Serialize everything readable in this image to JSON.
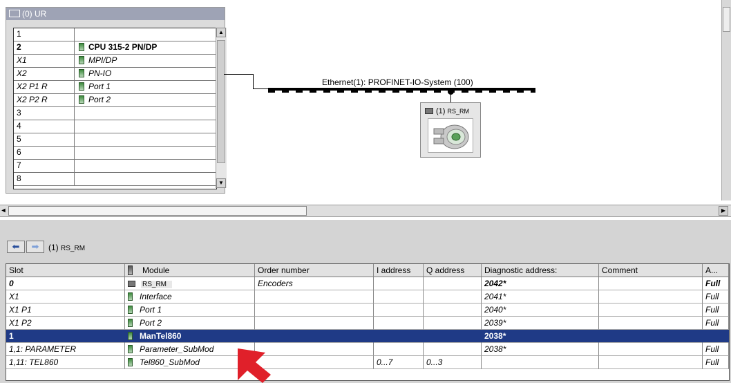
{
  "rack": {
    "title": "(0) UR",
    "rows": [
      {
        "slot": "1",
        "module": "",
        "icon": false,
        "style": ""
      },
      {
        "slot": "2",
        "module": "CPU 315-2 PN/DP",
        "icon": true,
        "style": "bold"
      },
      {
        "slot": "X1",
        "module": "MPI/DP",
        "icon": true,
        "style": "italic"
      },
      {
        "slot": "X2",
        "module": "PN-IO",
        "icon": true,
        "style": "italic"
      },
      {
        "slot": "X2 P1 R",
        "module": "Port 1",
        "icon": true,
        "style": "italic"
      },
      {
        "slot": "X2 P2 R",
        "module": "Port 2",
        "icon": true,
        "style": "italic"
      },
      {
        "slot": "3",
        "module": "",
        "icon": false,
        "style": ""
      },
      {
        "slot": "4",
        "module": "",
        "icon": false,
        "style": ""
      },
      {
        "slot": "5",
        "module": "",
        "icon": false,
        "style": ""
      },
      {
        "slot": "6",
        "module": "",
        "icon": false,
        "style": ""
      },
      {
        "slot": "7",
        "module": "",
        "icon": false,
        "style": ""
      },
      {
        "slot": "8",
        "module": "",
        "icon": false,
        "style": ""
      }
    ]
  },
  "network": {
    "label": "Ethernet(1): PROFINET-IO-System (100)",
    "device_label_prefix": "(1)",
    "device_label_name": "RS_RM"
  },
  "detail": {
    "nav_prefix": "(1)",
    "nav_name": "RS_RM",
    "columns": [
      "Slot",
      "Module",
      "Order number",
      "I address",
      "Q address",
      "Diagnostic address:",
      "Comment",
      "A..."
    ],
    "rows": [
      {
        "slot": "0",
        "module": "RS_RM",
        "order": "Encoders",
        "i": "",
        "q": "",
        "diag": "2042*",
        "comment": "",
        "a": "Full",
        "icon": "device",
        "style": "bolditalic"
      },
      {
        "slot": "X1",
        "module": "Interface",
        "order": "",
        "i": "",
        "q": "",
        "diag": "2041*",
        "comment": "",
        "a": "Full",
        "icon": "module",
        "style": "italic"
      },
      {
        "slot": "X1 P1",
        "module": "Port 1",
        "order": "",
        "i": "",
        "q": "",
        "diag": "2040*",
        "comment": "",
        "a": "Full",
        "icon": "module",
        "style": "italic"
      },
      {
        "slot": "X1 P2",
        "module": "Port 2",
        "order": "",
        "i": "",
        "q": "",
        "diag": "2039*",
        "comment": "",
        "a": "Full",
        "icon": "module",
        "style": "italic"
      },
      {
        "slot": "1",
        "module": "ManTel860",
        "order": "",
        "i": "",
        "q": "",
        "diag": "2038*",
        "comment": "",
        "a": "",
        "icon": "module",
        "style": "selected"
      },
      {
        "slot": "1,1: PARAMETER",
        "module": "Parameter_SubMod",
        "order": "",
        "i": "",
        "q": "",
        "diag": "2038*",
        "comment": "",
        "a": "Full",
        "icon": "module",
        "style": "italic"
      },
      {
        "slot": "1,11: TEL860",
        "module": "Tel860_SubMod",
        "order": "",
        "i": "0...7",
        "q": "0...3",
        "diag": "",
        "comment": "",
        "a": "Full",
        "icon": "module",
        "style": "italic"
      }
    ]
  },
  "colors": {
    "selection": "#1f3a86",
    "arrow": "#e0202a",
    "title_bar": "#9ea3b5"
  }
}
